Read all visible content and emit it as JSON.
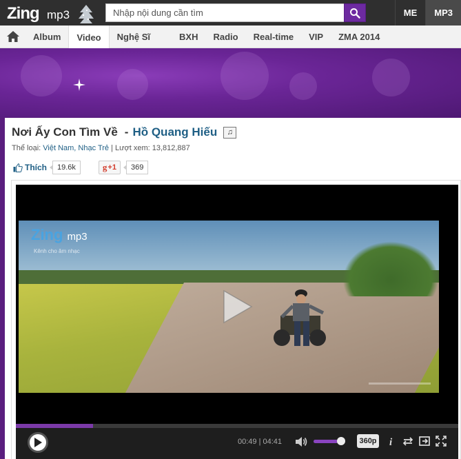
{
  "header": {
    "logo_text": "Zing",
    "logo_sub": "mp3",
    "search": {
      "placeholder": "Nhập nội dung cần tìm"
    },
    "top_links": [
      {
        "label": "ME",
        "active": false
      },
      {
        "label": "MP3",
        "active": true
      }
    ]
  },
  "nav": {
    "items_left": [
      "Album",
      "Video",
      "Nghệ Sĩ"
    ],
    "items_right": [
      "BXH",
      "Radio",
      "Real-time",
      "VIP",
      "ZMA 2014"
    ],
    "active": "Video"
  },
  "song": {
    "title": "Nơi Ấy Con Tìm Về",
    "separator": "-",
    "artist": "Hồ Quang Hiếu",
    "genre_label": "Thể loại:",
    "genres": "Việt Nam, Nhạc Trẻ",
    "views_label": "| Lượt xem:",
    "views": "13,812,887"
  },
  "social": {
    "like_label": "Thích",
    "like_count": "19.6k",
    "gplus_label": "+1",
    "gplus_count": "369"
  },
  "video_overlay": {
    "logo": "Zing",
    "logo_sub": "mp3",
    "tagline": "Kênh cho âm nhạc"
  },
  "player": {
    "current_time": "00:49",
    "duration": "04:41",
    "time_separator": " | ",
    "progress_fraction": 0.174,
    "volume_fraction": 0.75,
    "quality": "360p"
  },
  "colors": {
    "accent": "#6d2aa0",
    "link": "#1f5f85",
    "topbar": "#2f2f2f"
  }
}
